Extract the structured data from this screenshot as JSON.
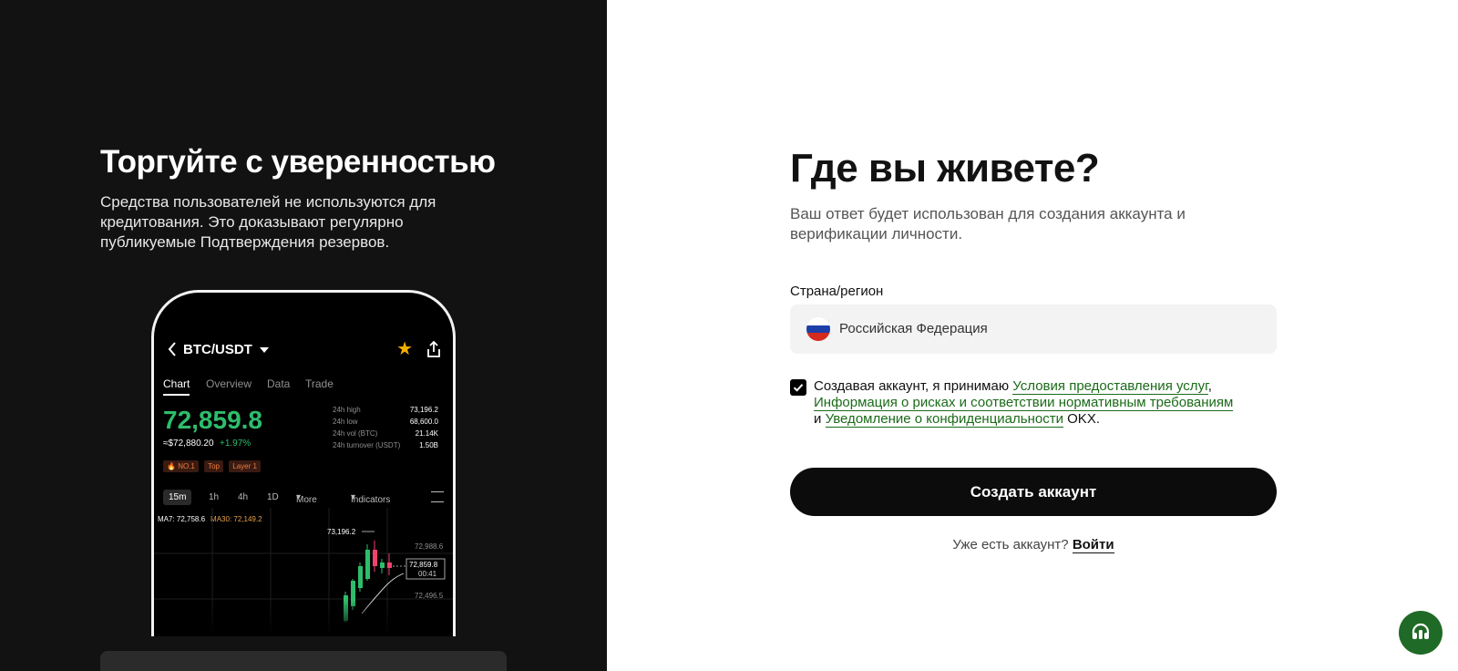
{
  "left": {
    "title": "Торгуйте с уверенностью",
    "desc_lines": [
      "Средства пользователей не используются для",
      "кредитования. Это доказывают регулярно",
      "публикуемые Подтверждения резервов."
    ]
  },
  "phone": {
    "pair": "BTC/USDT",
    "tabs": [
      "Chart",
      "Overview",
      "Data",
      "Trade"
    ],
    "price": "72,859.8",
    "approx": "≈$72,880.20",
    "change": "+1.97%",
    "stats": [
      {
        "label": "24h high",
        "value": "73,196.2"
      },
      {
        "label": "24h low",
        "value": "68,600.0"
      },
      {
        "label": "24h vol (BTC)",
        "value": "21.14K"
      },
      {
        "label": "24h turnover (USDT)",
        "value": "1.50B"
      }
    ],
    "tags": [
      "NO.1",
      "Top",
      "Layer 1"
    ],
    "timeframes": [
      "15m",
      "1h",
      "4h",
      "1D",
      "More",
      "Indicators"
    ],
    "ma7": "MA7: 72,758.6",
    "ma30": "MA30: 72,149.2",
    "chart_labels": {
      "high": "73,196.2",
      "level1": "72,988.6",
      "current": "72,859.8",
      "timer": "00:41",
      "level2": "72,496.5"
    },
    "colors": {
      "up": "#2ebd6b",
      "down": "#f0446c",
      "star": "#f5b000"
    }
  },
  "form": {
    "title": "Где вы живете?",
    "desc_lines": [
      "Ваш ответ будет использован для создания аккаунта и",
      "верификации личности."
    ],
    "country_label": "Страна/регион",
    "country_value": "Российская Федерация",
    "agree_prefix": "Создавая аккаунт, я принимаю",
    "terms_link": "Условия предоставления услуг",
    "comma": ",",
    "risk_link": "Информация о рисках и соответствии нормативным требованиям",
    "and": "и",
    "privacy_link": "Уведомление о конфиденциальности",
    "brand_suffix": "OKX.",
    "agree_checked": true,
    "create_button": "Создать аккаунт",
    "login_prompt": "Уже есть аккаунт?",
    "login_link": "Войти"
  },
  "support": {
    "icon": "support-chat-icon",
    "color": "#1f6a27"
  }
}
